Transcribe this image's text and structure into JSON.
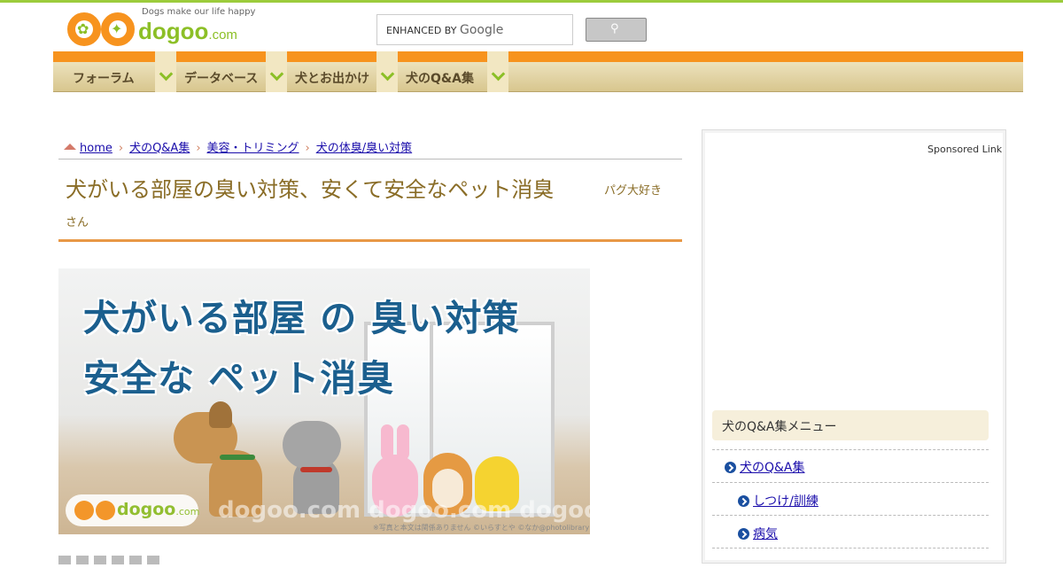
{
  "header": {
    "tagline": "Dogs make our life happy",
    "brand_name": "dogoo",
    "brand_tld": ".com",
    "search_prefix": "ENHANCED BY",
    "search_brand": "Google"
  },
  "nav": {
    "items": [
      {
        "label": "フォーラム"
      },
      {
        "label": "データベース"
      },
      {
        "label": "犬とお出かけ"
      },
      {
        "label": "犬のQ&A集"
      }
    ]
  },
  "breadcrumb": {
    "items": [
      {
        "label": "home"
      },
      {
        "label": "犬のQ&A集"
      },
      {
        "label": "美容・トリミング"
      },
      {
        "label": "犬の体臭/臭い対策"
      }
    ]
  },
  "article": {
    "title": "犬がいる部屋の臭い対策、安くて安全なペット消臭",
    "author_part1": "パグ大好き",
    "author_part2": "さん"
  },
  "hero": {
    "line1": "犬がいる部屋 の 臭い対策",
    "line2": "安全な ペット消臭",
    "watermark_brand": "dogoo",
    "watermark_tld": ".com",
    "watermark_repeat": "dogoo.com dogoo.com dogoo",
    "credit": "※写真と本文は関係ありません ©いらすとや ©なか@photolibrary"
  },
  "sidebar": {
    "sponsored": "Sponsored Link",
    "menu_title": "犬のQ&A集メニュー",
    "menu_items": [
      {
        "label": "犬のQ&A集"
      },
      {
        "label": "しつけ/訓練"
      },
      {
        "label": "病気"
      }
    ]
  },
  "colors": {
    "accent_orange": "#f7931e",
    "brand_green": "#8cbf26",
    "title_brown": "#8a6d27",
    "hero_text_blue": "#1b5f8e",
    "link_blue": "#1a0dab"
  }
}
